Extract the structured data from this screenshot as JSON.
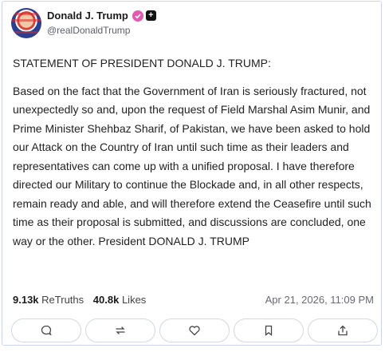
{
  "post": {
    "author_name": "Donald J. Trump",
    "handle": "@realDonaldTrump",
    "headline": "STATEMENT OF PRESIDENT DONALD J. TRUMP:",
    "body": "Based on the fact that the Government of Iran is seriously fractured, not unexpectedly so and, upon the request of Field Marshal Asim Munir, and Prime Minister Shehbaz Sharif, of Pakistan, we have been asked to hold our Attack on the Country of Iran until such time as their leaders and representatives can come up with a unified proposal. I have therefore directed our Military to continue the Blockade and, in all other respects, remain ready and able, and will therefore extend the Ceasefire until such time as their proposal is submitted, and discussions are concluded, one way or the other. President DONALD J. TRUMP",
    "retruths_count": "9.13k",
    "retruths_label": "ReTruths",
    "likes_count": "40.8k",
    "likes_label": "Likes",
    "timestamp": "Apr 21, 2026, 11:09 PM"
  },
  "icons": {
    "verified": "verified-badge-icon",
    "plus": "plus-badge-icon",
    "reply": "reply-icon",
    "retruth": "retruth-icon",
    "like": "like-icon",
    "bookmark": "bookmark-icon",
    "share": "share-icon"
  },
  "colors": {
    "border": "#cfd3f2",
    "verified": "#e25bb0",
    "muted_text": "#666a76"
  }
}
